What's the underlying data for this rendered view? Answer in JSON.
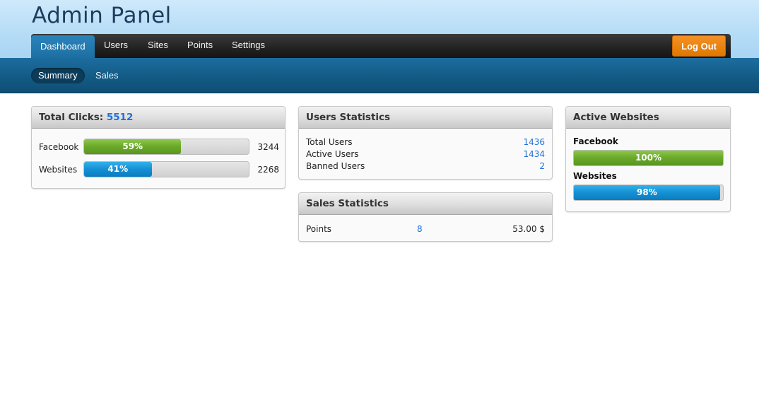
{
  "header": {
    "title": "Admin Panel"
  },
  "nav": {
    "tabs": [
      {
        "label": "Dashboard",
        "active": true
      },
      {
        "label": "Users",
        "active": false
      },
      {
        "label": "Sites",
        "active": false
      },
      {
        "label": "Points",
        "active": false
      },
      {
        "label": "Settings",
        "active": false
      }
    ],
    "logout_label": "Log Out"
  },
  "subnav": {
    "items": [
      {
        "label": "Summary",
        "active": true
      },
      {
        "label": "Sales",
        "active": false
      }
    ]
  },
  "total_clicks": {
    "title": "Total Clicks:",
    "value": "5512",
    "rows": [
      {
        "label": "Facebook",
        "percent": 59,
        "percent_text": "59%",
        "count": "3244",
        "color": "#6aa82a"
      },
      {
        "label": "Websites",
        "percent": 41,
        "percent_text": "41%",
        "count": "2268",
        "color": "#1590d4"
      }
    ]
  },
  "users_statistics": {
    "title": "Users Statistics",
    "rows": [
      {
        "label": "Total Users",
        "value": "1436"
      },
      {
        "label": "Active Users",
        "value": "1434"
      },
      {
        "label": "Banned Users",
        "value": "2"
      }
    ]
  },
  "sales_statistics": {
    "title": "Sales Statistics",
    "row": {
      "label": "Points",
      "count": "8",
      "amount": "53.00 $"
    }
  },
  "active_websites": {
    "title": "Active Websites",
    "items": [
      {
        "label": "Facebook",
        "percent": 100,
        "percent_text": "100%",
        "color": "#6aa82a"
      },
      {
        "label": "Websites",
        "percent": 98,
        "percent_text": "98%",
        "color": "#1590d4"
      }
    ]
  },
  "colors": {
    "link": "#1f6fd6",
    "logout": "#e07800",
    "subnav": "#135983"
  }
}
